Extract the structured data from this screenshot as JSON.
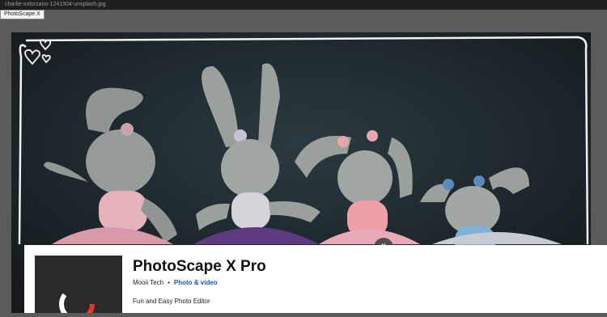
{
  "window": {
    "file_name": "charlie-solorzano-1241504-unsplash.jpg",
    "tooltip": "PhotoScape X"
  },
  "media": {
    "pause_glyph": "II",
    "description_icon": "hearts-doodle-icon"
  },
  "app": {
    "name": "PhotoScape X Pro",
    "publisher": "Mooii Tech",
    "separator": "•",
    "category": "Photo & video",
    "tagline": "Fun and Easy Photo Editor"
  },
  "colors": {
    "category_link": "#0a5fb4",
    "icon_bg": "#2a2a2a",
    "icon_ring_red": "#e03a2f"
  }
}
